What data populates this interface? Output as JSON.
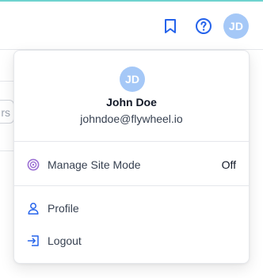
{
  "header": {
    "icons": {
      "bookmark": "bookmark-icon",
      "help": "help-circle-icon"
    },
    "avatar_initials": "JD"
  },
  "background": {
    "partial_input_text": "rs"
  },
  "user_menu": {
    "avatar_initials": "JD",
    "name": "John Doe",
    "email": "johndoe@flywheel.io",
    "items": [
      {
        "label": "Manage Site Mode",
        "value": "Off",
        "icon": "site-mode-icon"
      },
      {
        "label": "Profile",
        "icon": "user-icon"
      },
      {
        "label": "Logout",
        "icon": "logout-icon"
      }
    ]
  },
  "colors": {
    "accent_line": "#6fd3cf",
    "icon_blue": "#2563eb",
    "avatar_bg": "#a5c8f7",
    "site_mode_purple": "#9b6fd3"
  }
}
